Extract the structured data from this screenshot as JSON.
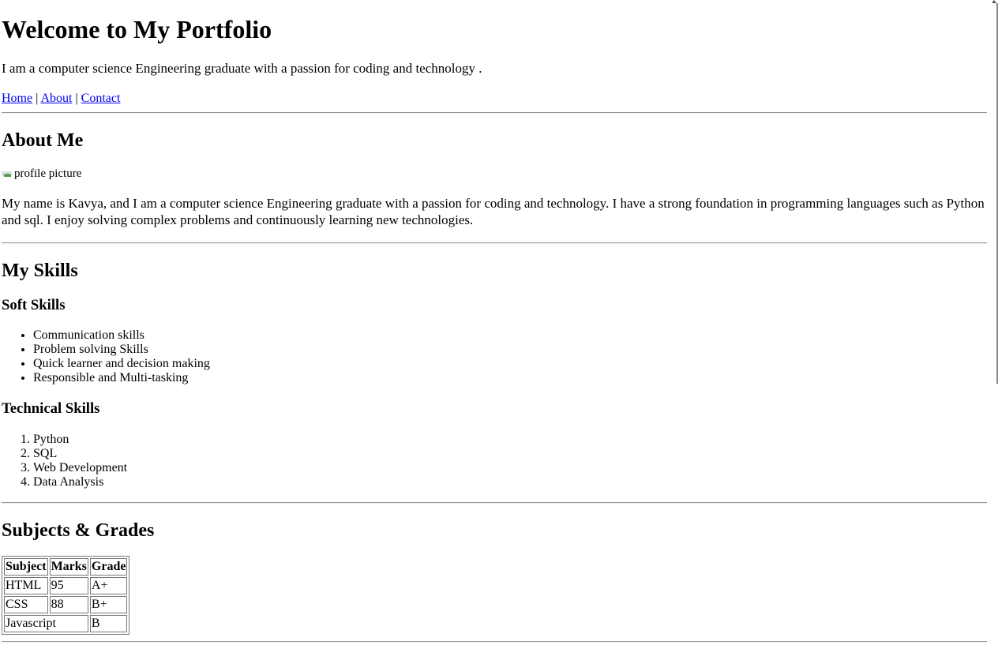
{
  "header": {
    "title": "Welcome to My Portfolio",
    "intro": "I am a computer science Engineering graduate with a passion for coding and technology .",
    "nav": [
      {
        "label": "Home"
      },
      {
        "label": "About"
      },
      {
        "label": "Contact"
      }
    ],
    "nav_separator": "|"
  },
  "about": {
    "heading": "About Me",
    "image_alt": "profile picture",
    "text": "My name is Kavya, and I am a computer science Engineering graduate with a passion for coding and technology. I have a strong foundation in programming languages such as Python and sql. I enjoy solving complex problems and continuously learning new technologies."
  },
  "skills": {
    "heading": "My Skills",
    "soft": {
      "heading": "Soft Skills",
      "items": [
        "Communication skills",
        "Problem solving Skills",
        "Quick learner and decision making",
        "Responsible and Multi-tasking"
      ]
    },
    "technical": {
      "heading": "Technical Skills",
      "items": [
        "Python",
        "SQL",
        "Web Development",
        "Data Analysis"
      ]
    }
  },
  "grades": {
    "heading": "Subjects & Grades",
    "columns": [
      "Subject",
      "Marks",
      "Grade"
    ],
    "rows": [
      [
        "HTML",
        "95",
        "A+"
      ],
      [
        "CSS",
        "88",
        "B+"
      ],
      [
        "Javascript",
        "B"
      ]
    ]
  },
  "icons": {
    "broken_image": "broken-image-icon"
  }
}
